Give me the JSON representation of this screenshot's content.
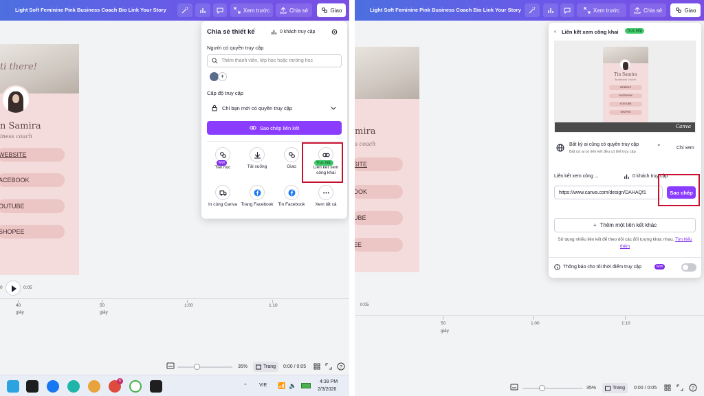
{
  "left": {
    "topbar": {
      "title": "Light Soft Feminine Pink Business Coach Bio Link Your Story",
      "preview_label": "Xem trước",
      "share_label": "Chia sẻ",
      "assign_label": "Giao"
    },
    "design": {
      "script_greeting": "ti there!",
      "name": "n Samira",
      "subtitle": "iness coach",
      "links": [
        "WEBSITE",
        "ACEBOOK",
        "OUTUBE",
        "SHOPEE"
      ]
    },
    "timeline": {
      "time": "0:05",
      "ticks": [
        "40",
        "50",
        "1:00",
        "1:10"
      ],
      "unit": "giây"
    },
    "statusbar": {
      "zoom": "35%",
      "page_label": "Trang",
      "duration": "0:00 / 0:05"
    },
    "taskbar": {
      "lang": "VIE",
      "time": "4:39 PM",
      "date": "2/3/2026",
      "notif_count": "6"
    },
    "share_popup": {
      "title": "Chia sẻ thiết kế",
      "visitors": "0 khách truy cập",
      "people_label": "Người có quyền truy cập",
      "search_placeholder": "Thêm thành viên, lớp học hoặc trường học",
      "access_level_label": "Cấp độ truy cập",
      "access_value": "Chỉ bạn mới có quyền truy cập",
      "copy_link": "Sao chép liên kết",
      "options_row1": [
        {
          "icon": "template-icon",
          "label": "Tiết học",
          "badge": "Mới"
        },
        {
          "icon": "download-icon",
          "label": "Tải xuống",
          "badge": ""
        },
        {
          "icon": "assign-icon",
          "label": "Giao",
          "badge": ""
        },
        {
          "icon": "link-icon",
          "label": "Liên kết xem công khai",
          "badge": "Trực tiếp"
        }
      ],
      "options_row2": [
        {
          "icon": "truck-icon",
          "label": "In cùng Canva"
        },
        {
          "icon": "facebook-icon",
          "label": "Trang Facebook"
        },
        {
          "icon": "facebook-icon",
          "label": "Tin Facebook"
        },
        {
          "icon": "more-icon",
          "label": "Xem tất cả"
        }
      ]
    }
  },
  "right": {
    "topbar": {
      "title": "Light Soft Feminine Pink Business Coach Bio Link Your Story",
      "preview_label": "Xem trước",
      "share_label": "Chia sẻ",
      "assign_label": "Giao"
    },
    "design": {
      "name": "mira",
      "subtitle": "s coach",
      "links": [
        "SITE",
        "OOK",
        "UBE",
        "EE"
      ]
    },
    "timeline": {
      "time": "0:05",
      "ticks": [
        "50",
        "1:00",
        "1:10"
      ],
      "unit": "giây"
    },
    "statusbar": {
      "zoom": "35%",
      "page_label": "Trang",
      "duration": "0:00 / 0:05"
    },
    "link_popup": {
      "back_title": "Liên kết xem công khai",
      "live_badge": "Trực tiếp",
      "preview_name": "Tin Samira",
      "preview_sub": "business coach",
      "preview_links": [
        "WEBSITE",
        "FACEBOOK",
        "YOUTUBE",
        "SHOPEE"
      ],
      "canva_mark": "Canva",
      "access_title": "Bất kỳ ai cũng có quyền truy cập",
      "access_sub": "Bất cứ ai có liên kết đều có thể truy cập",
      "access_mode": "Chỉ xem",
      "link_label": "Liên kết xem công ...",
      "visitors": "0 khách truy cập",
      "url": "https://www.canva.com/design/DAHAQf1",
      "copy_label": "Sao chép",
      "add_link": "Thêm một liên kết khác",
      "help_text": "Sử dụng nhiều liên kết để theo dõi các đối tượng khác nhau.",
      "help_link": "Tìm hiểu thêm",
      "notify_label": "Thông báo cho tôi thời điểm truy cập",
      "notify_badge": "Mới"
    }
  }
}
